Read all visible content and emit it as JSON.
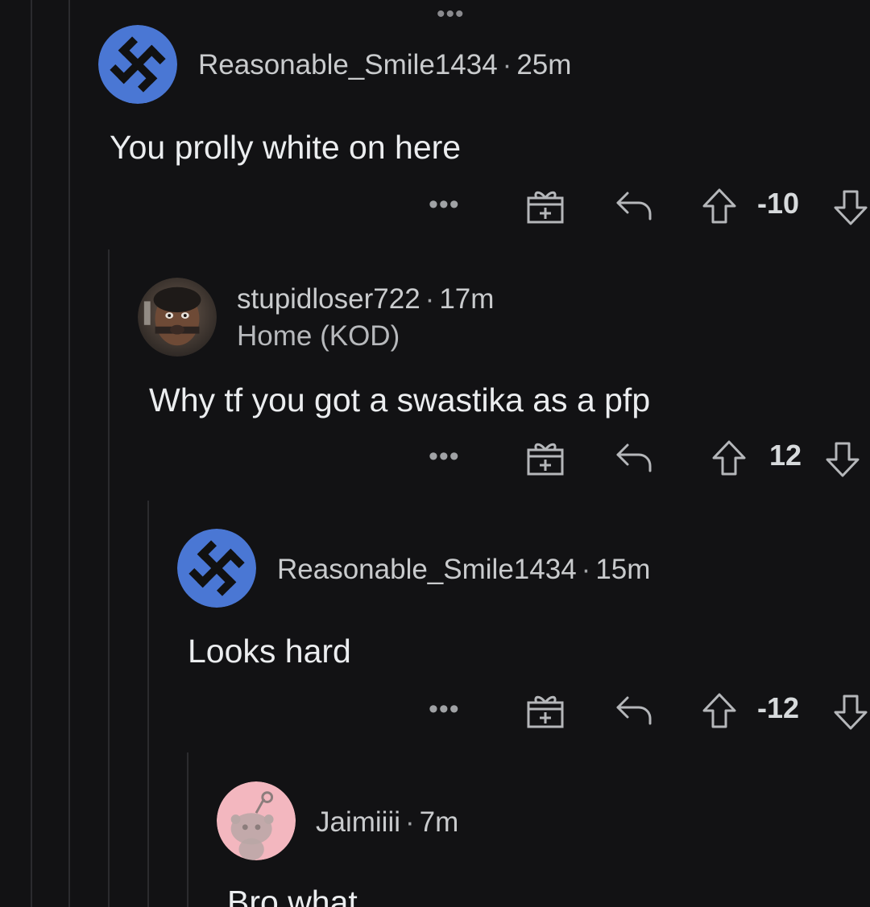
{
  "top_more": "•••",
  "comments": [
    {
      "username": "Reasonable_Smile1434",
      "separator": "·",
      "time": "25m",
      "flair": "",
      "body": "You prolly white on here",
      "more": "•••",
      "score": "-10",
      "avatar": "swastika-avatar"
    },
    {
      "username": "stupidloser722",
      "separator": "·",
      "time": "17m",
      "flair": "Home (KOD)",
      "body": "Why tf you got a swastika as a pfp",
      "more": "•••",
      "score": "12",
      "avatar": "photo-avatar"
    },
    {
      "username": "Reasonable_Smile1434",
      "separator": "·",
      "time": "15m",
      "flair": "",
      "body": "Looks hard",
      "more": "•••",
      "score": "-12",
      "avatar": "swastika-avatar"
    },
    {
      "username": "Jaimiiii",
      "separator": "·",
      "time": "7m",
      "flair": "",
      "body": "Bro what",
      "avatar": "snoo-avatar"
    }
  ],
  "colors": {
    "background": "#121214",
    "avatar_blue": "#4a77d4",
    "avatar_pink": "#f3b7bf",
    "thread_line": "#2b2b2e"
  }
}
